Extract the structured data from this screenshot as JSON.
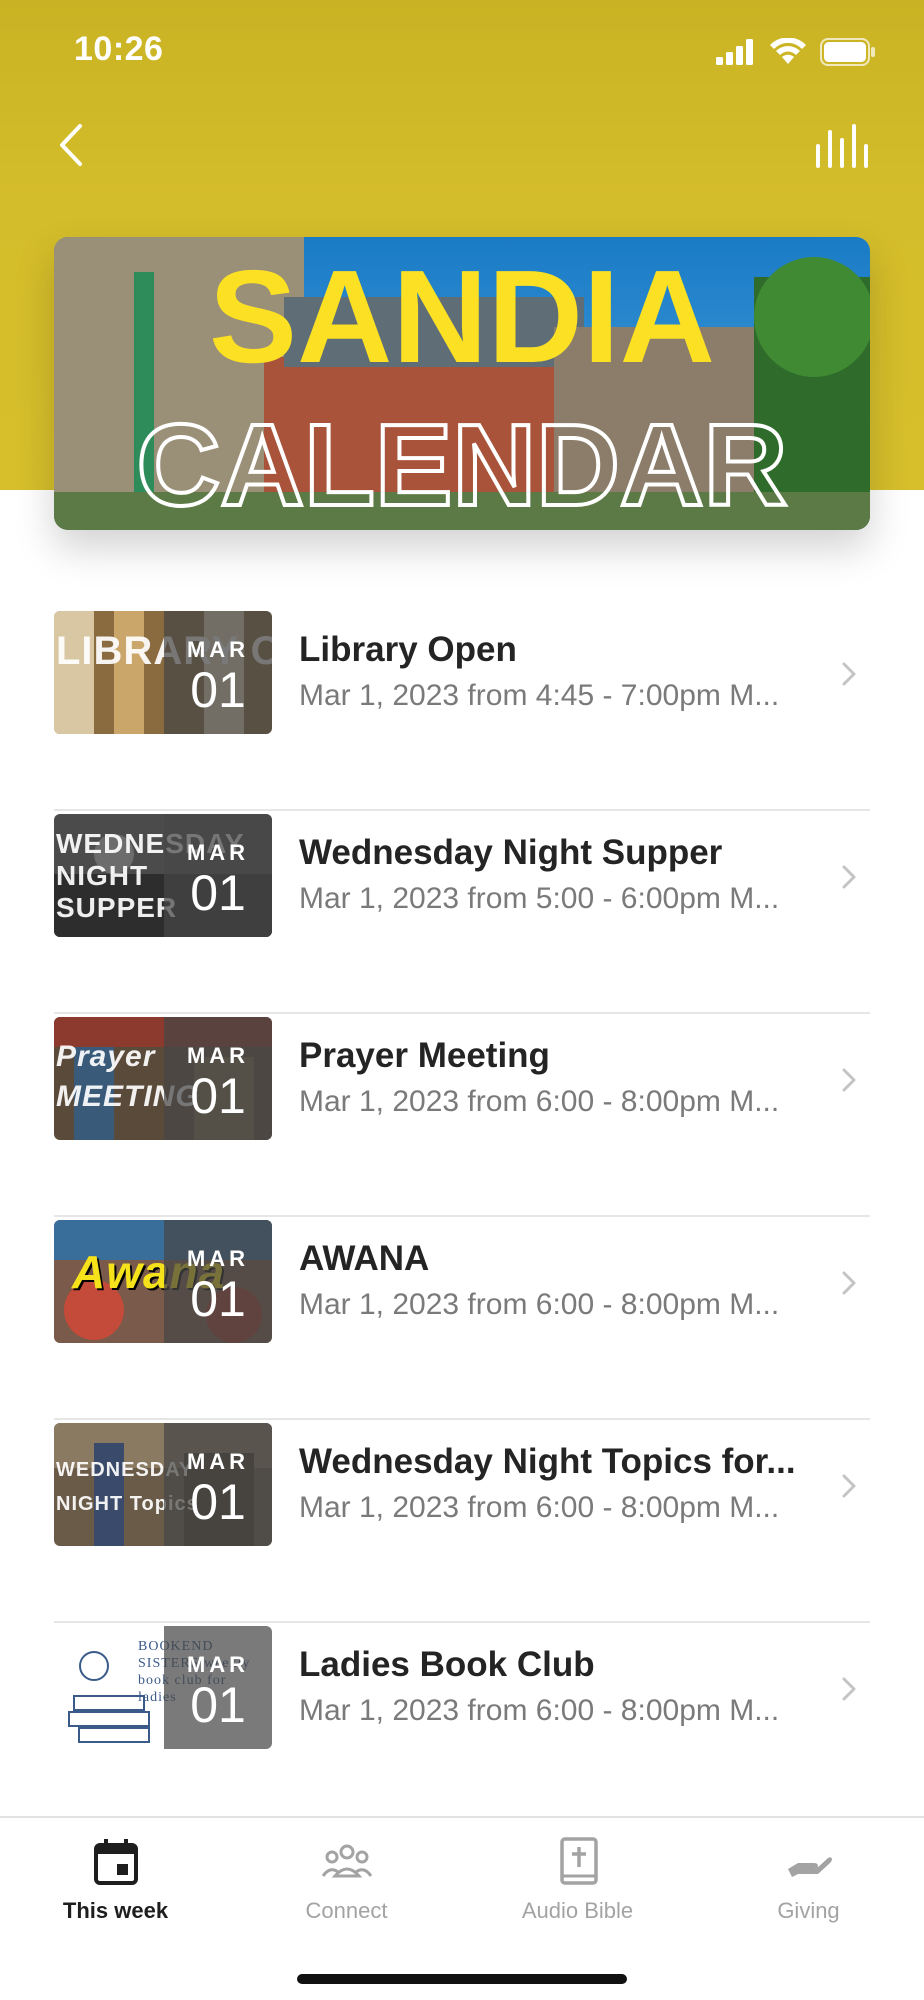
{
  "status_bar": {
    "time": "10:26"
  },
  "banner": {
    "line1": "SANDIA",
    "line2": "CALENDAR",
    "accent_color": "#fbe023"
  },
  "events": [
    {
      "title": "Library Open",
      "subtitle": "Mar 1, 2023 from 4:45 - 7:00pm M...",
      "month": "MAR",
      "day": "01",
      "thumb_text": "LIBRARY OPEN"
    },
    {
      "title": "Wednesday Night Supper",
      "subtitle": "Mar 1, 2023 from 5:00 - 6:00pm M...",
      "month": "MAR",
      "day": "01",
      "thumb_text": "WEDNESDAY NIGHT SUPPER"
    },
    {
      "title": "Prayer Meeting",
      "subtitle": "Mar 1, 2023 from 6:00 - 8:00pm M...",
      "month": "MAR",
      "day": "01",
      "thumb_text": "Prayer MEETING"
    },
    {
      "title": "AWANA",
      "subtitle": "Mar 1, 2023 from 6:00 - 8:00pm M...",
      "month": "MAR",
      "day": "01",
      "thumb_text": "Awana"
    },
    {
      "title": "Wednesday Night Topics for...",
      "subtitle": "Mar 1, 2023 from 6:00 - 8:00pm M...",
      "month": "MAR",
      "day": "01",
      "thumb_text": "WEDNESDAY NIGHT Topics"
    },
    {
      "title": "Ladies Book Club",
      "subtitle": "Mar 1, 2023 from 6:00 - 8:00pm M...",
      "month": "MAR",
      "day": "01",
      "thumb_text": "BOOKEND SISTERS weekly book club for ladies"
    }
  ],
  "tabs": [
    {
      "label": "This week",
      "icon": "calendar-icon",
      "active": true
    },
    {
      "label": "Connect",
      "icon": "people-group-icon",
      "active": false
    },
    {
      "label": "Audio Bible",
      "icon": "bible-icon",
      "active": false
    },
    {
      "label": "Giving",
      "icon": "hand-giving-icon",
      "active": false
    }
  ],
  "colors": {
    "header_yellow": "#d4bd2a",
    "text_primary": "#242424",
    "text_secondary": "#7a7a7a"
  }
}
